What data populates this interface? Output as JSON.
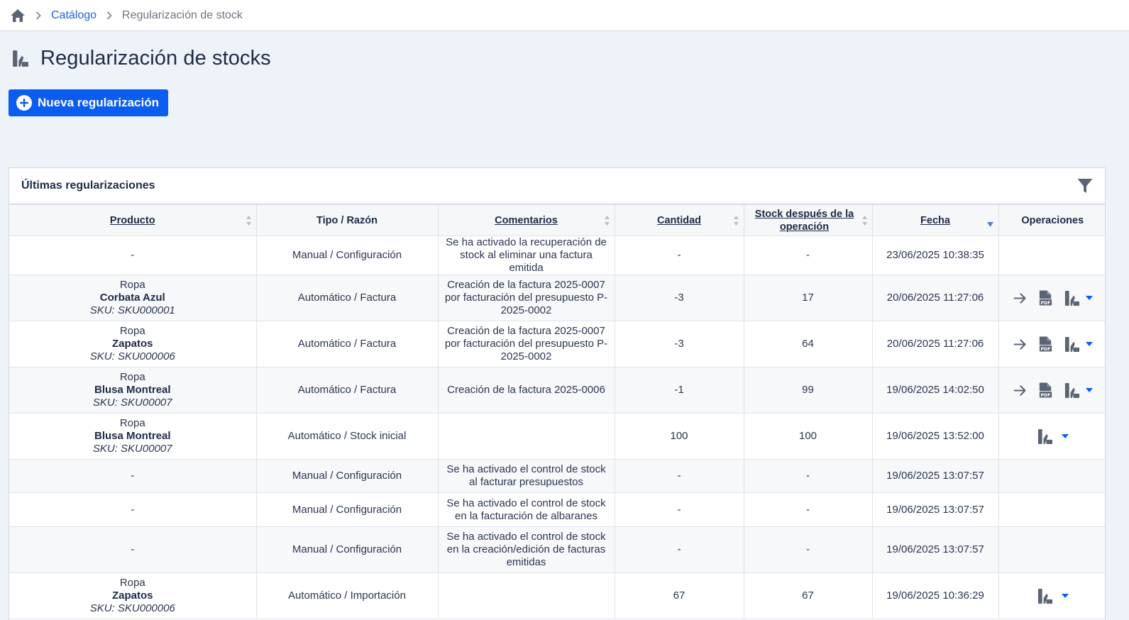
{
  "breadcrumb": {
    "home_icon": "home-icon",
    "items": [
      "Catálogo",
      "Regularización de stock"
    ]
  },
  "page": {
    "title": "Regularización de stocks",
    "new_button": "Nueva regularización"
  },
  "panel": {
    "title": "Últimas regularizaciones",
    "filter_icon": "filter-icon"
  },
  "table": {
    "headers": {
      "producto": "Producto",
      "tipo": "Tipo / Razón",
      "comentarios": "Comentarios",
      "cantidad": "Cantidad",
      "stock": "Stock después de la operación",
      "fecha": "Fecha",
      "operaciones": "Operaciones"
    },
    "rows": [
      {
        "producto": "-",
        "tipo": "Manual / Configuración",
        "comentarios": "Se ha activado la recuperación de stock al eliminar una factura emitida",
        "cantidad": "-",
        "stock": "-",
        "fecha": "23/06/2025 10:38:35"
      },
      {
        "categoria": "Ropa",
        "nombre": "Corbata Azul",
        "sku": "SKU: SKU000001",
        "tipo": "Automático / Factura",
        "comentarios": "Creación de la factura 2025-0007 por facturación del presupuesto P-2025-0002",
        "cantidad": "-3",
        "stock": "17",
        "fecha": "20/06/2025 11:27:06"
      },
      {
        "categoria": "Ropa",
        "nombre": "Zapatos",
        "sku": "SKU: SKU000006",
        "tipo": "Automático / Factura",
        "comentarios": "Creación de la factura 2025-0007 por facturación del presupuesto P-2025-0002",
        "cantidad": "-3",
        "stock": "64",
        "fecha": "20/06/2025 11:27:06"
      },
      {
        "categoria": "Ropa",
        "nombre": "Blusa Montreal",
        "sku": "SKU: SKU00007",
        "tipo": "Automático / Factura",
        "comentarios": "Creación de la factura 2025-0006",
        "cantidad": "-1",
        "stock": "99",
        "fecha": "19/06/2025 14:02:50"
      },
      {
        "categoria": "Ropa",
        "nombre": "Blusa Montreal",
        "sku": "SKU: SKU00007",
        "tipo": "Automático / Stock inicial",
        "comentarios": "",
        "cantidad": "100",
        "stock": "100",
        "fecha": "19/06/2025 13:52:00"
      },
      {
        "producto": "-",
        "tipo": "Manual / Configuración",
        "comentarios": "Se ha activado el control de stock al facturar presupuestos",
        "cantidad": "-",
        "stock": "-",
        "fecha": "19/06/2025 13:07:57"
      },
      {
        "producto": "-",
        "tipo": "Manual / Configuración",
        "comentarios": "Se ha activado el control de stock en la facturación de albaranes",
        "cantidad": "-",
        "stock": "-",
        "fecha": "19/06/2025 13:07:57"
      },
      {
        "producto": "-",
        "tipo": "Manual / Configuración",
        "comentarios": "Se ha activado el control de stock en la creación/edición de facturas emitidas",
        "cantidad": "-",
        "stock": "-",
        "fecha": "19/06/2025 13:07:57"
      },
      {
        "categoria": "Ropa",
        "nombre": "Zapatos",
        "sku": "SKU: SKU000006",
        "tipo": "Automático / Importación",
        "comentarios": "",
        "cantidad": "67",
        "stock": "67",
        "fecha": "19/06/2025 10:36:29"
      }
    ]
  },
  "colors": {
    "accent": "#0b5cf0",
    "text": "#1d2b45",
    "icon": "#5b6474"
  }
}
